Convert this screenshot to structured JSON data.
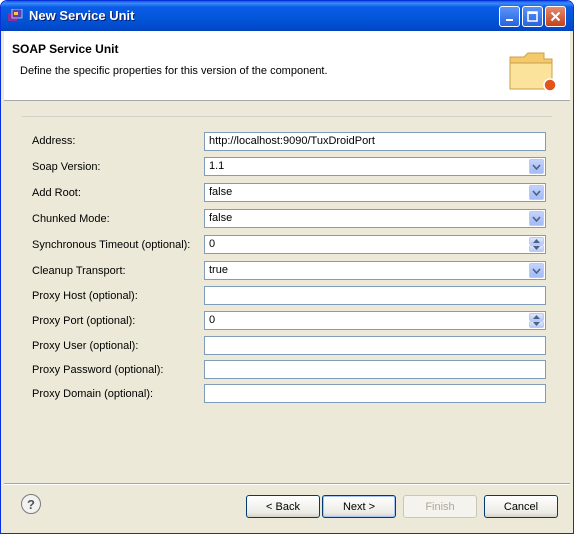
{
  "window": {
    "title": "New Service Unit"
  },
  "banner": {
    "title": "SOAP Service Unit",
    "description": "Define the specific properties for this version of the component."
  },
  "form": {
    "fields": [
      {
        "label": "Address:",
        "value": "http://localhost:9090/TuxDroidPort",
        "kind": "text"
      },
      {
        "label": "Soap Version:",
        "value": "1.1",
        "kind": "combo"
      },
      {
        "label": "Add Root:",
        "value": "false",
        "kind": "combo"
      },
      {
        "label": "Chunked Mode:",
        "value": "false",
        "kind": "combo"
      },
      {
        "label": "Synchronous Timeout (optional):",
        "value": "0",
        "kind": "spinner"
      },
      {
        "label": "Cleanup Transport:",
        "value": "true",
        "kind": "combo"
      },
      {
        "label": "Proxy Host (optional):",
        "value": "",
        "kind": "text"
      },
      {
        "label": "Proxy Port (optional):",
        "value": "0",
        "kind": "spinner"
      },
      {
        "label": "Proxy User (optional):",
        "value": "",
        "kind": "text"
      },
      {
        "label": "Proxy Password (optional):",
        "value": "",
        "kind": "text"
      },
      {
        "label": "Proxy Domain (optional):",
        "value": "",
        "kind": "text"
      }
    ]
  },
  "buttons": {
    "help": "?",
    "back": "< Back",
    "next": "Next >",
    "finish": "Finish",
    "cancel": "Cancel"
  },
  "icons": {
    "title": "eclipse-app-icon",
    "banner": "folder-wizard-icon",
    "help": "help-icon"
  },
  "colors": {
    "titlebar": "#0255d6",
    "window_bg": "#ece9d8",
    "field_border": "#7f9db9"
  }
}
